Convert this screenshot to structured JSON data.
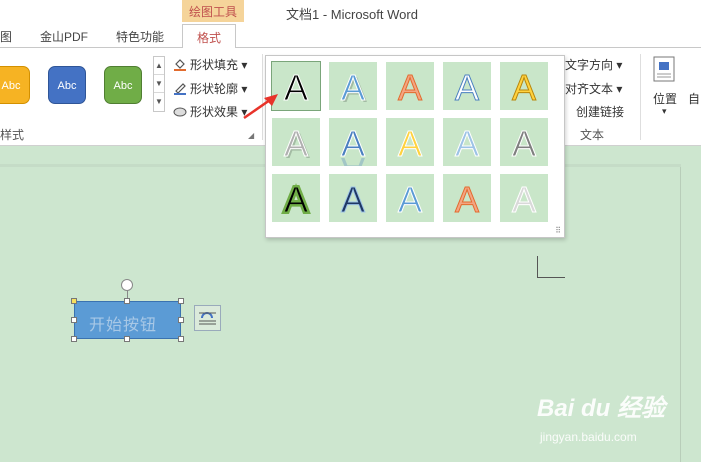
{
  "titlebar": {
    "context_tab": "绘图工具",
    "doc_title": "文档1 - Microsoft Word"
  },
  "tabs": [
    {
      "label": "图"
    },
    {
      "label": "金山PDF"
    },
    {
      "label": "特色功能"
    },
    {
      "label": "格式",
      "active": true
    }
  ],
  "ribbon": {
    "shape_styles": [
      {
        "label": "Abc",
        "color": "#f6b323"
      },
      {
        "label": "Abc",
        "color": "#4472c4"
      },
      {
        "label": "Abc",
        "color": "#70ad47"
      }
    ],
    "shape_styles_group_label": "样式",
    "shape_commands": {
      "fill": "形状填充",
      "outline": "形状轮廓",
      "effects": "形状效果"
    },
    "text_commands": {
      "direction": "文字方向",
      "align": "对齐文本",
      "link": "创建链接"
    },
    "text_group_label": "文本",
    "position_label": "位置",
    "auto_wrap_label": "自"
  },
  "wordart_gallery": {
    "rows": [
      [
        {
          "letter": "A",
          "fill": "#000000",
          "stroke": "#ffffff",
          "shadow": "none"
        },
        {
          "letter": "A",
          "fill": "#5b9bd5",
          "stroke": "#ffffff",
          "shadow": "soft"
        },
        {
          "letter": "A",
          "fill": "#f4a582",
          "stroke": "#e26b2e",
          "shadow": "none"
        },
        {
          "letter": "A",
          "fill": "#ffffff",
          "stroke": "#4a7fc0",
          "shadow": "none"
        },
        {
          "letter": "A",
          "fill": "#ffd23f",
          "stroke": "#b8860b",
          "shadow": "none"
        }
      ],
      [
        {
          "letter": "A",
          "fill": "#b0b0b0",
          "stroke": "#ffffff",
          "shadow": "soft"
        },
        {
          "letter": "A",
          "fill": "#4a7fc0",
          "stroke": "#ffffff",
          "shadow": "reflection"
        },
        {
          "letter": "A",
          "fill": "#ffd23f",
          "stroke": "#ffffff",
          "shadow": "none"
        },
        {
          "letter": "A",
          "fill": "#9dc3e6",
          "stroke": "#ffffff",
          "shadow": "none"
        },
        {
          "letter": "A",
          "fill": "#7f7f7f",
          "stroke": "#ffffff",
          "shadow": "none"
        }
      ],
      [
        {
          "letter": "A",
          "fill": "#000000",
          "stroke": "#70ad47",
          "shadow": "glow"
        },
        {
          "letter": "A",
          "fill": "#1f3864",
          "stroke": "#9dc3e6",
          "shadow": "none"
        },
        {
          "letter": "A",
          "fill": "#5b9bd5",
          "stroke": "#ffffff",
          "shadow": "none"
        },
        {
          "letter": "A",
          "fill": "#f4a582",
          "stroke": "#e26b2e",
          "shadow": "none"
        },
        {
          "letter": "A",
          "fill": "#d9d9d9",
          "stroke": "#ffffff",
          "shadow": "none"
        }
      ]
    ]
  },
  "document": {
    "textbox_text": "开始按钮"
  },
  "watermark": {
    "logo": "Bai du 经验",
    "url": "jingyan.baidu.com"
  }
}
